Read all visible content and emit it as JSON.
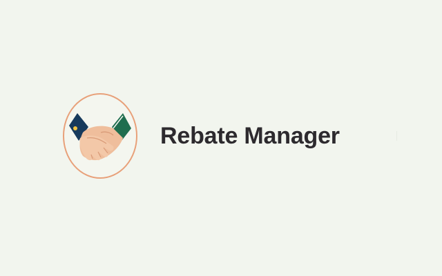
{
  "app": {
    "title": "Rebate Manager",
    "logo_icon": "handshake-icon"
  },
  "colors": {
    "background": "#f2f5ee",
    "title_text": "#2d2a2e",
    "logo_ring": "#e8a079",
    "skin": "#efbe9c",
    "skin_shade": "#d99b78",
    "left_sleeve": "#173a5c",
    "right_sleeve": "#1f6e4f",
    "badge": "#f2c443"
  }
}
